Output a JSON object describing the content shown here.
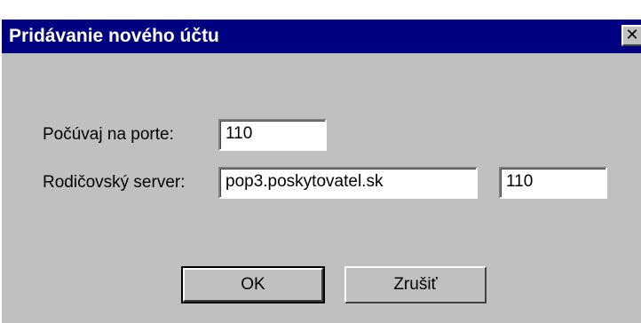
{
  "dialog": {
    "title": "Pridávanie nového účtu",
    "close_icon": "close-icon"
  },
  "form": {
    "listen_port_label": "Počúvaj na porte:",
    "listen_port_value": "110",
    "parent_server_label": "Rodičovský server:",
    "parent_server_value": "pop3.poskytovatel.sk",
    "parent_port_value": "110"
  },
  "buttons": {
    "ok_label": "OK",
    "cancel_label": "Zrušiť"
  },
  "colors": {
    "titlebar": "#000080",
    "face": "#c0c0c0"
  }
}
